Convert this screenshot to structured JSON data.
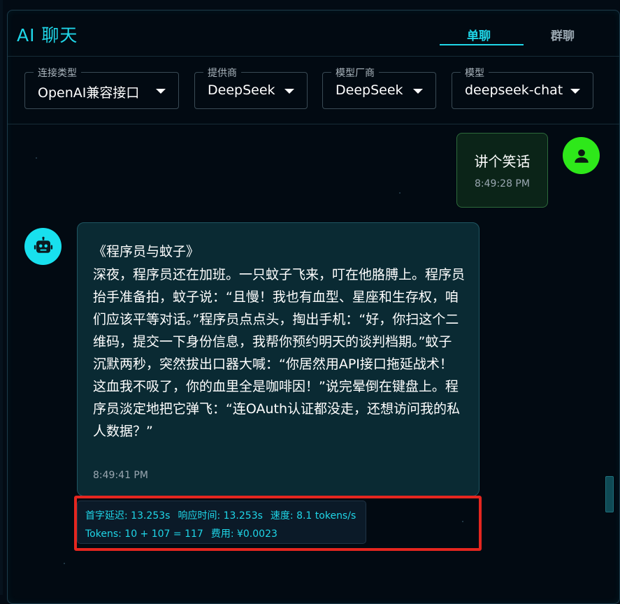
{
  "app": {
    "title": "AI 聊天",
    "tabs": [
      {
        "label": "单聊",
        "active": true
      },
      {
        "label": "群聊",
        "active": false
      }
    ]
  },
  "controls": {
    "connection_type": {
      "label": "连接类型",
      "value": "OpenAI兼容接口"
    },
    "provider": {
      "label": "提供商",
      "value": "DeepSeek"
    },
    "model_vendor": {
      "label": "模型厂商",
      "value": "DeepSeek"
    },
    "model": {
      "label": "模型",
      "value": "deepseek-chat"
    }
  },
  "messages": {
    "user": {
      "text": "讲个笑话",
      "time": "8:49:28 PM"
    },
    "bot": {
      "title": "《程序员与蚊子》",
      "body": "深夜，程序员还在加班。一只蚊子飞来，叮在他胳膊上。程序员抬手准备拍，蚊子说：“且慢！我也有血型、星座和生存权，咱们应该平等对话。”程序员点点头，掏出手机：“好，你扫这个二维码，提交一下身份信息，我帮你预约明天的谈判档期。”蚊子沉默两秒，突然拔出口器大喊：“你居然用API接口拖延战术！这血我不吸了，你的血里全是咖啡因！”说完晕倒在键盘上。程序员淡定地把它弹飞：“连OAuth认证都没走，还想访问我的私人数据？”",
      "time": "8:49:41 PM"
    }
  },
  "stats": {
    "first_token_latency": "首字延迟: 13.253s",
    "response_time": "响应时间: 13.253s",
    "speed": "速度: 8.1 tokens/s",
    "tokens": "Tokens: 10 + 107 = 117",
    "cost": "费用: ¥0.0023"
  },
  "colors": {
    "accent": "#1fd6e8",
    "user_avatar": "#2ee81a",
    "bot_avatar": "#18e0ee",
    "highlight": "#e5261f"
  }
}
